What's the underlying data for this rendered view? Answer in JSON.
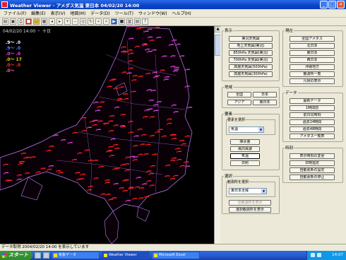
{
  "window": {
    "title": "Weather Viewer - アメダス気温 東日本 04/02/20 14:00",
    "minimize": "_",
    "maximize": "□",
    "close": "×"
  },
  "menu": [
    "ファイル(F)",
    "編集(E)",
    "表示(V)",
    "地図(M)",
    "データ(D)",
    "ツール(T)",
    "ウィンドウ(W)",
    "ヘルプ(H)"
  ],
  "toolbar_icons": [
    "open-icon",
    "save-icon",
    "print-icon",
    "red-square-icon",
    "folder-icon",
    "grid-icon",
    "back-icon",
    "forward-icon",
    "zoom-in-icon",
    "zoom-out-icon",
    "zoom-fit-icon",
    "refresh-icon",
    "prev-icon",
    "next-icon",
    "play-icon",
    "stop-icon",
    "chart-icon",
    "table-icon",
    "help-icon"
  ],
  "map": {
    "date_label": "04/02/20 14:00 ・ 十日",
    "legend": [
      {
        "label": ".9～ .0",
        "color": "#ffffff"
      },
      {
        "label": ".9～ .0",
        "color": "#4a8cff"
      },
      {
        "label": ".0～ .0",
        "color": "#ff40ff"
      },
      {
        "label": ".0～ 17",
        "color": "#ffd000"
      },
      {
        "label": ".0～ .0",
        "color": "#ff3030"
      },
      {
        "label": ".0～",
        "color": "#ff60c0"
      }
    ],
    "colors": {
      "primary": "#ff2020",
      "secondary": "#e040e0",
      "coast": "#c080ff"
    }
  },
  "panel": {
    "groups": {
      "display": "表示",
      "region": "地域",
      "element": "要素",
      "select": "選択",
      "current": "現在",
      "data": "データ",
      "time": "時刻"
    },
    "display_buttons": [
      "実況天気図",
      "地上天気図(実況)",
      "850hPa 天気図(実況)",
      "700hPa 天気図(実況)",
      "高層天気図(500hPa)",
      "高層天気図(300hPa)"
    ],
    "region_buttons": [
      "全国",
      "日本",
      "アジア",
      "東日本"
    ],
    "element_label": "要素を選択",
    "element_value": "気温",
    "element_buttons": [
      "降水量",
      "風向風速",
      "気温",
      "日照"
    ],
    "select_label": "観測所を選択",
    "select_value": "東日本全域",
    "select_buttons": [
      "全観測所を表示",
      "選択観測所を表示"
    ],
    "current_buttons": [
      "全国アメダス",
      "北日本",
      "東日本",
      "西日本",
      "沖縄地方",
      "観測所一覧",
      "凡例の表示"
    ],
    "data_buttons": [
      "最新データ",
      "1時間前",
      "前日同時刻",
      "過去24時間",
      "過去48時間",
      "アメダス一覧表"
    ],
    "time_buttons": [
      "表示時刻の変更",
      "日時指定",
      "自動更新の設定",
      "自動更新の停止"
    ]
  },
  "status": "データ取得 2004/02/20 14:00 を表示しています",
  "taskbar": {
    "start": "スタート",
    "tasks": [
      "Weather Viewer",
      "気象データ",
      "Microsoft Excel"
    ],
    "clock": "14:07"
  }
}
